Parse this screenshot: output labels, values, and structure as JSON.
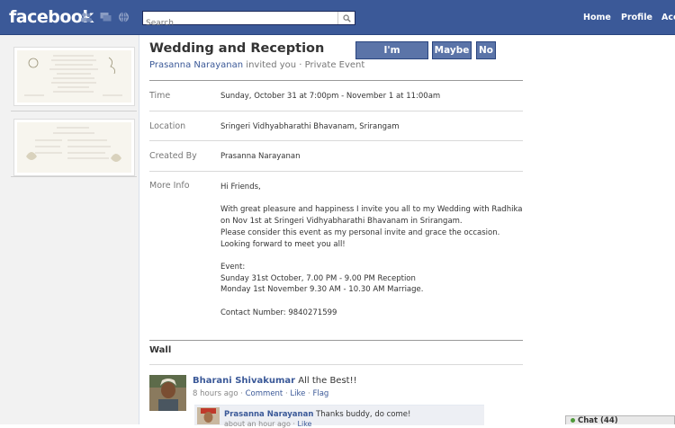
{
  "header": {
    "logo": "facebook",
    "search_placeholder": "Search",
    "nav": [
      "Home",
      "Profile",
      "Acc"
    ]
  },
  "event": {
    "title": "Wedding and Reception",
    "inviter": "Prasanna Narayanan",
    "invite_suffix": " invited you · Private Event",
    "buttons": {
      "attending": "I'm Attending",
      "maybe": "Maybe",
      "no": "No"
    },
    "details": {
      "time_label": "Time",
      "time_value": "Sunday, October 31 at 7:00pm - November 1 at 11:00am",
      "location_label": "Location",
      "location_value": "Sringeri Vidhyabharathi Bhavanam, Srirangam",
      "created_label": "Created By",
      "created_value": "Prasanna Narayanan",
      "more_label": "More Info"
    },
    "more_info": [
      "Hi Friends,",
      "",
      "With great pleasure and happiness I invite you all to my Wedding with Radhika on Nov 1st at Sringeri Vidhyabharathi Bhavanam in Srirangam.",
      "Please consider this event as my personal invite and grace the occasion.",
      "Looking forward to meet you all!",
      "",
      "Event:",
      "Sunday 31st October, 7.00 PM - 9.00 PM Reception",
      "Monday 1st November 9.30 AM - 10.30 AM Marriage.",
      "",
      "Contact Number: 9840271599"
    ]
  },
  "wall": {
    "heading": "Wall",
    "post": {
      "author": "Bharani Shivakumar",
      "text": " All the Best!!",
      "time": "8 hours ago",
      "sep": " · ",
      "comment": "Comment",
      "like": "Like",
      "flag": "Flag"
    },
    "reply": {
      "author": "Prasanna Narayanan",
      "text": " Thanks buddy, do come!",
      "time": "about an hour ago",
      "like": "Like"
    }
  },
  "chat": {
    "label": "Chat (44)"
  },
  "colors": {
    "brand": "#3b5998",
    "button": "#5b74a8"
  }
}
